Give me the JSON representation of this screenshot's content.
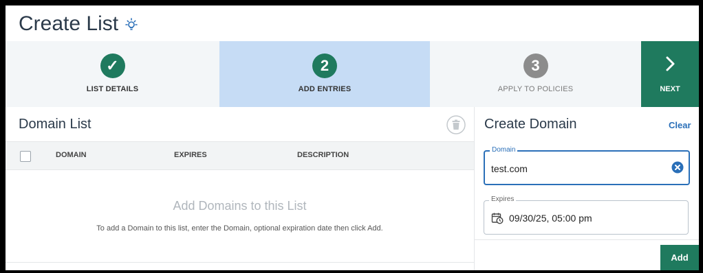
{
  "header": {
    "title": "Create List",
    "icon": "lightbulb-icon"
  },
  "stepper": {
    "steps": [
      {
        "number": "✓",
        "label": "LIST DETAILS",
        "state": "completed"
      },
      {
        "number": "2",
        "label": "ADD ENTRIES",
        "state": "active"
      },
      {
        "number": "3",
        "label": "APPLY TO POLICIES",
        "state": "pending"
      }
    ],
    "next_label": "NEXT"
  },
  "domain_list": {
    "title": "Domain List",
    "columns": [
      "DOMAIN",
      "EXPIRES",
      "DESCRIPTION"
    ],
    "rows": [],
    "empty_title": "Add Domains to this List",
    "empty_text": "To add a Domain to this list, enter the Domain, optional expiration date then click Add."
  },
  "create_domain": {
    "title": "Create Domain",
    "clear_label": "Clear",
    "domain_legend": "Domain",
    "domain_value": "test.com",
    "expires_legend": "Expires",
    "expires_value": "09/30/25, 05:00 pm",
    "add_label": "Add"
  },
  "colors": {
    "brand_green": "#1f7a5e",
    "active_step_bg": "#c6dcf5",
    "accent_blue": "#2a6fb8",
    "pending_gray": "#8c8c8c"
  }
}
